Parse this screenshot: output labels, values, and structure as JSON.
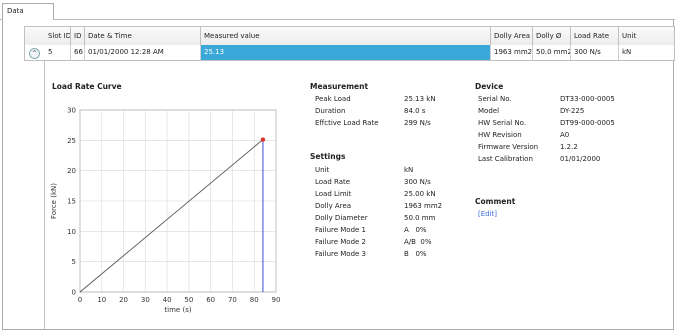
{
  "tab": {
    "label": "Data"
  },
  "grid": {
    "columns": [
      "Slot ID",
      "ID",
      "Date & Time",
      "Measured value",
      "Dolly Area",
      "Dolly Ø",
      "Load Rate",
      "Unit"
    ],
    "row": {
      "expander": "^",
      "slot_id": "5",
      "id": "66",
      "datetime": "01/01/2000 12:28 AM",
      "measured": "25.13",
      "dolly_area": "1963 mm2",
      "dolly_diameter": "50.0 mm2",
      "load_rate": "300 N/s",
      "unit": "kN"
    }
  },
  "chart_title": "Load Rate Curve",
  "chart_data": {
    "type": "line",
    "title": "Load Rate Curve",
    "xlabel": "time (s)",
    "ylabel": "Force (kN)",
    "xlim": [
      0,
      90
    ],
    "ylim": [
      0,
      30
    ],
    "xticks": [
      "0",
      "10",
      "20",
      "30",
      "40",
      "50",
      "60",
      "70",
      "80",
      "90"
    ],
    "yticks": [
      "0",
      "5",
      "10",
      "15",
      "20",
      "25",
      "30"
    ],
    "grid": true,
    "series": [
      {
        "x": [
          0,
          84.0,
          84.0
        ],
        "y": [
          0,
          25.13,
          0
        ],
        "color": "#555555"
      }
    ],
    "peak": {
      "x": 84.0,
      "y": 25.13,
      "color": "#e03030"
    },
    "drop_line_color": "#3b4bd8"
  },
  "measurement": {
    "heading": "Measurement",
    "rows": [
      {
        "label": "Peak Load",
        "value": "25.13 kN"
      },
      {
        "label": "Duration",
        "value": "84.0 s"
      },
      {
        "label": "Effctive Load Rate",
        "value": "299 N/s"
      }
    ]
  },
  "settings": {
    "heading": "Settings",
    "rows": [
      {
        "label": "Unit",
        "value": "kN"
      },
      {
        "label": "Load Rate",
        "value": "300 N/s"
      },
      {
        "label": "Load Limit",
        "value": "25.00 kN"
      },
      {
        "label": "Dolly Area",
        "value": "1963 mm2"
      },
      {
        "label": "Dolly Diameter",
        "value": "50.0 mm"
      },
      {
        "label": "Failure Mode 1",
        "value": "A   0%"
      },
      {
        "label": "Failure Mode 2",
        "value": "A/B  0%"
      },
      {
        "label": "Failure Mode 3",
        "value": "B   0%"
      }
    ]
  },
  "device": {
    "heading": "Device",
    "rows": [
      {
        "label": "Serial No.",
        "value": "DT33-000-0005"
      },
      {
        "label": "Model",
        "value": "DY-225"
      },
      {
        "label": "HW Serial No.",
        "value": "DT99-000-0005"
      },
      {
        "label": "HW Revision",
        "value": "A0"
      },
      {
        "label": "Firmware Version",
        "value": "1.2.2"
      },
      {
        "label": "Last Calibration",
        "value": "01/01/2000"
      }
    ]
  },
  "comment": {
    "heading": "Comment",
    "edit_link": "[Edit]"
  }
}
